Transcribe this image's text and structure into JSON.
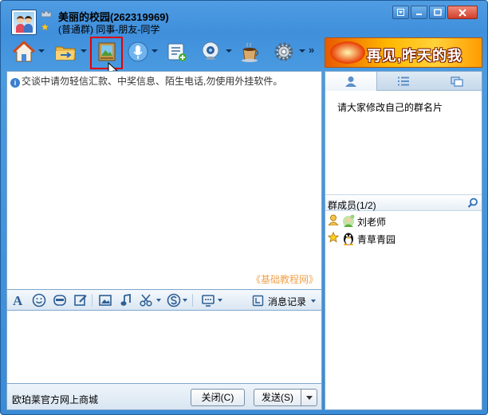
{
  "window": {
    "group_name": "美丽的校园(262319969)",
    "group_type": "(普通群) 同事-朋友-同学",
    "controls": {
      "restore_label": "▢",
      "close_label": "✕"
    }
  },
  "toolbar": {
    "items": [
      {
        "name": "group-home",
        "icon": "house-icon"
      },
      {
        "name": "group-share",
        "icon": "folder-icon"
      },
      {
        "name": "group-album",
        "icon": "photo-album-icon",
        "highlighted": true
      },
      {
        "name": "voice",
        "icon": "microphone-icon"
      },
      {
        "name": "group-post",
        "icon": "bulletin-icon"
      },
      {
        "name": "video",
        "icon": "webcam-icon"
      },
      {
        "name": "coffee",
        "icon": "coffee-cup-icon"
      },
      {
        "name": "settings",
        "icon": "gear-icon"
      }
    ],
    "more_label": "»"
  },
  "banner": {
    "text": "再见,昨天的我"
  },
  "chat": {
    "notice": "交谈中请勿轻信汇款、中奖信息、陌生电话,勿使用外挂软件。",
    "watermark": "《基础教程网》"
  },
  "input_toolbar": {
    "history_label": "消息记录"
  },
  "bottom": {
    "store_link": "欧珀莱官方网上商城",
    "close_button": "关闭(C)",
    "send_button": "发送(S)"
  },
  "right_panel": {
    "announcement": "请大家修改自己的群名片",
    "members_title": "群成员(1/2)",
    "members": [
      {
        "name": "刘老师",
        "role": "owner"
      },
      {
        "name": "青草青园",
        "role": "admin"
      }
    ]
  },
  "colors": {
    "title_bar": "#3f8fdc",
    "highlight": "#e00000",
    "watermark": "#f3a14a"
  }
}
